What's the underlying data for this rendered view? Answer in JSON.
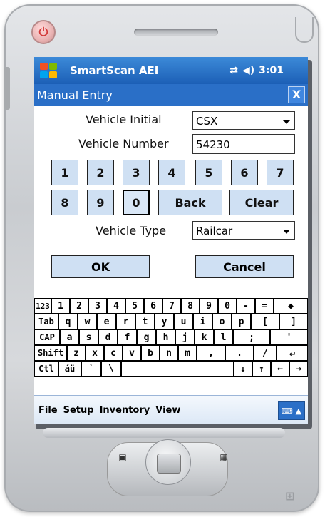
{
  "app": {
    "name": "SmartScan AEI",
    "time": "3:01"
  },
  "dialog": {
    "title": "Manual Entry",
    "close_label": "X"
  },
  "form": {
    "vehicle_initial_label": "Vehicle Initial",
    "vehicle_initial_value": "CSX",
    "vehicle_number_label": "Vehicle Number",
    "vehicle_number_value": "54230",
    "vehicle_type_label": "Vehicle Type",
    "vehicle_type_value": "Railcar",
    "ok_label": "OK",
    "cancel_label": "Cancel"
  },
  "keypad": {
    "row1": [
      "1",
      "2",
      "3",
      "4",
      "5",
      "6",
      "7"
    ],
    "row2": [
      "8",
      "9",
      "0"
    ],
    "back_label": "Back",
    "clear_label": "Clear",
    "selected_key": "0"
  },
  "soft_keyboard": {
    "row1": [
      "123",
      "1",
      "2",
      "3",
      "4",
      "5",
      "6",
      "7",
      "8",
      "9",
      "0",
      "-",
      "=",
      "◆"
    ],
    "row2": [
      "Tab",
      "q",
      "w",
      "e",
      "r",
      "t",
      "y",
      "u",
      "i",
      "o",
      "p",
      "[",
      "]"
    ],
    "row3": [
      "CAP",
      "a",
      "s",
      "d",
      "f",
      "g",
      "h",
      "j",
      "k",
      "l",
      ";",
      "'"
    ],
    "row4": [
      "Shift",
      "z",
      "x",
      "c",
      "v",
      "b",
      "n",
      "m",
      ",",
      ".",
      "/",
      "↵"
    ],
    "row5": [
      "Ctl",
      "áü",
      "`",
      "\\",
      "",
      "↓",
      "↑",
      "←",
      "→"
    ]
  },
  "menu": {
    "items": [
      "File",
      "Setup",
      "Inventory",
      "View"
    ]
  },
  "colors": {
    "titlebar": "#1c5fb6",
    "button_fill": "#cfe0f3"
  }
}
